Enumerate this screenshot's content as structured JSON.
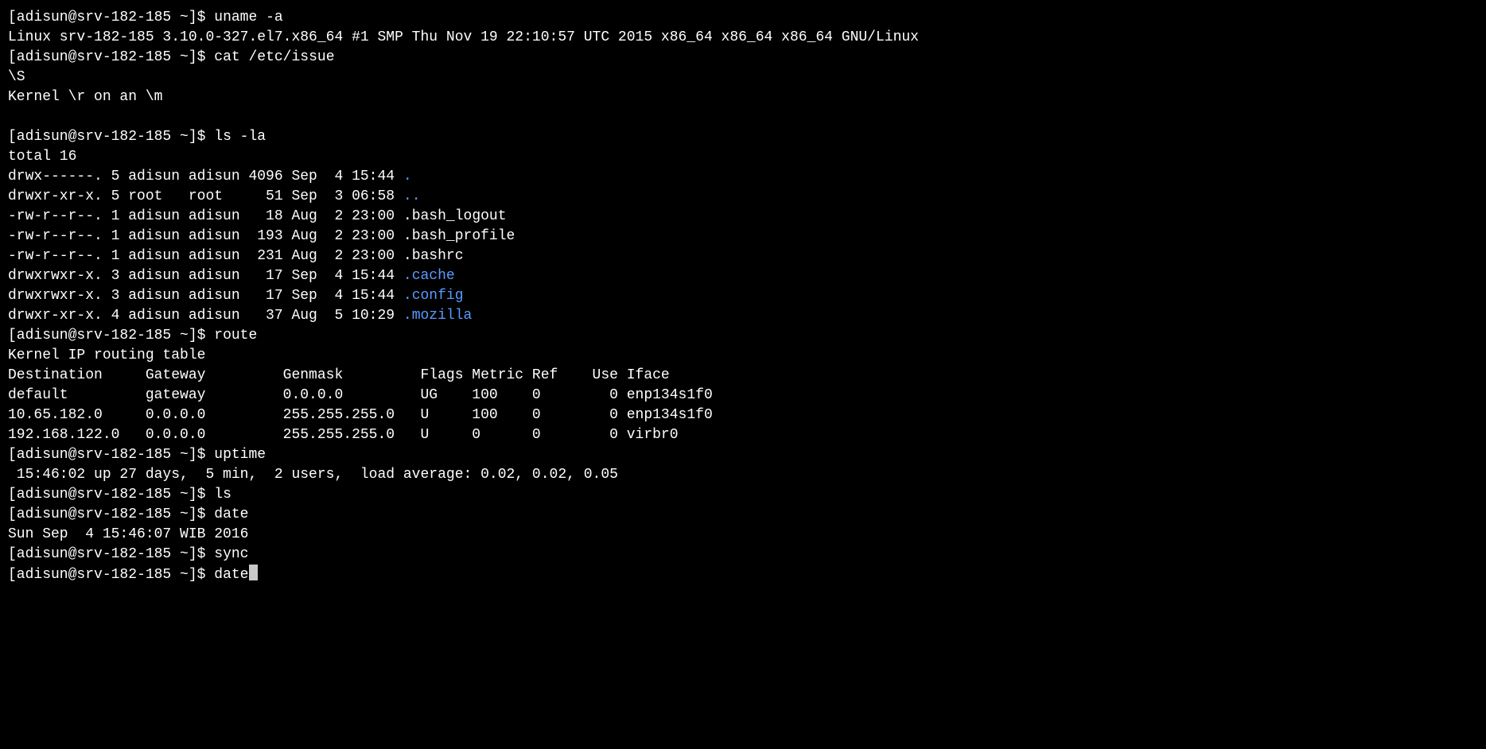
{
  "prompt_text": "[adisun@srv-182-185 ~]$",
  "cmd1": {
    "prompt": "[adisun@srv-182-185 ~]$",
    "command": "uname -a",
    "output": "Linux srv-182-185 3.10.0-327.el7.x86_64 #1 SMP Thu Nov 19 22:10:57 UTC 2015 x86_64 x86_64 x86_64 GNU/Linux"
  },
  "cmd2": {
    "prompt": "[adisun@srv-182-185 ~]$",
    "command": "cat /etc/issue",
    "output_line1": "\\S",
    "output_line2": "Kernel \\r on an \\m"
  },
  "cmd3": {
    "prompt": "[adisun@srv-182-185 ~]$",
    "command": "ls -la",
    "total": "total 16",
    "rows": [
      {
        "meta": "drwx------. 5 adisun adisun 4096 Sep  4 15:44",
        "name": ".",
        "color": "blue"
      },
      {
        "meta": "drwxr-xr-x. 5 root   root     51 Sep  3 06:58",
        "name": "..",
        "color": "blue"
      },
      {
        "meta": "-rw-r--r--. 1 adisun adisun   18 Aug  2 23:00",
        "name": ".bash_logout",
        "color": "white"
      },
      {
        "meta": "-rw-r--r--. 1 adisun adisun  193 Aug  2 23:00",
        "name": ".bash_profile",
        "color": "white"
      },
      {
        "meta": "-rw-r--r--. 1 adisun adisun  231 Aug  2 23:00",
        "name": ".bashrc",
        "color": "white"
      },
      {
        "meta": "drwxrwxr-x. 3 adisun adisun   17 Sep  4 15:44",
        "name": ".cache",
        "color": "blue"
      },
      {
        "meta": "drwxrwxr-x. 3 adisun adisun   17 Sep  4 15:44",
        "name": ".config",
        "color": "blue"
      },
      {
        "meta": "drwxr-xr-x. 4 adisun adisun   37 Aug  5 10:29",
        "name": ".mozilla",
        "color": "blue"
      }
    ]
  },
  "cmd4": {
    "prompt": "[adisun@srv-182-185 ~]$",
    "command": "route",
    "title": "Kernel IP routing table",
    "header": "Destination     Gateway         Genmask         Flags Metric Ref    Use Iface",
    "rows": [
      "default         gateway         0.0.0.0         UG    100    0        0 enp134s1f0",
      "10.65.182.0     0.0.0.0         255.255.255.0   U     100    0        0 enp134s1f0",
      "192.168.122.0   0.0.0.0         255.255.255.0   U     0      0        0 virbr0"
    ]
  },
  "cmd5": {
    "prompt": "[adisun@srv-182-185 ~]$",
    "command": "uptime",
    "output": " 15:46:02 up 27 days,  5 min,  2 users,  load average: 0.02, 0.02, 0.05"
  },
  "cmd6": {
    "prompt": "[adisun@srv-182-185 ~]$",
    "command": "ls"
  },
  "cmd7": {
    "prompt": "[adisun@srv-182-185 ~]$",
    "command": "date",
    "output": "Sun Sep  4 15:46:07 WIB 2016"
  },
  "cmd8": {
    "prompt": "[adisun@srv-182-185 ~]$",
    "command": "sync"
  },
  "cmd9": {
    "prompt": "[adisun@srv-182-185 ~]$",
    "command": "date"
  }
}
